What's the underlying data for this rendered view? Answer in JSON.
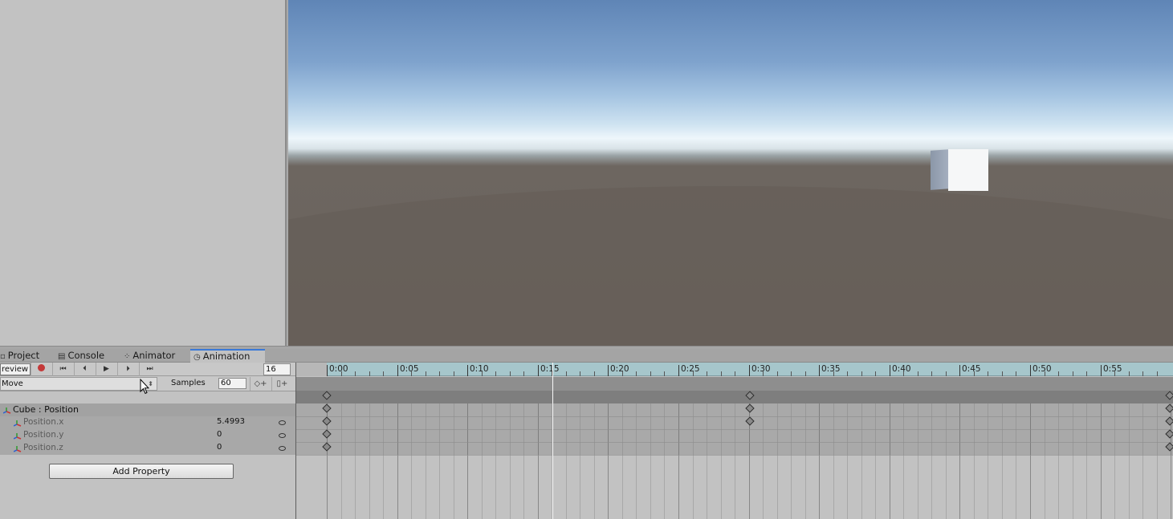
{
  "tabs": [
    {
      "label": "Project",
      "icon": "folder-icon"
    },
    {
      "label": "Console",
      "icon": "console-icon"
    },
    {
      "label": "Animator",
      "icon": "animator-icon"
    },
    {
      "label": "Animation",
      "icon": "clock-icon",
      "active": true
    }
  ],
  "toolbar": {
    "preview_label": "review",
    "frame_value": "16",
    "clip_name": "Move",
    "samples_label": "Samples",
    "samples_value": "60"
  },
  "properties": {
    "group": "Cube : Position",
    "items": [
      {
        "name": "Position.x",
        "value": "5.4993"
      },
      {
        "name": "Position.y",
        "value": "0"
      },
      {
        "name": "Position.z",
        "value": "0"
      }
    ],
    "add_button": "Add Property"
  },
  "timeline": {
    "labels": [
      "0:00",
      "0:05",
      "0:10",
      "0:15",
      "0:20",
      "0:25",
      "0:30",
      "0:35",
      "0:40",
      "0:45",
      "0:50",
      "0:55"
    ],
    "playhead_frame": 16
  },
  "colors": {
    "accent": "#3a79d8",
    "record": "#c43939",
    "ruler": "#a6c6cb"
  }
}
